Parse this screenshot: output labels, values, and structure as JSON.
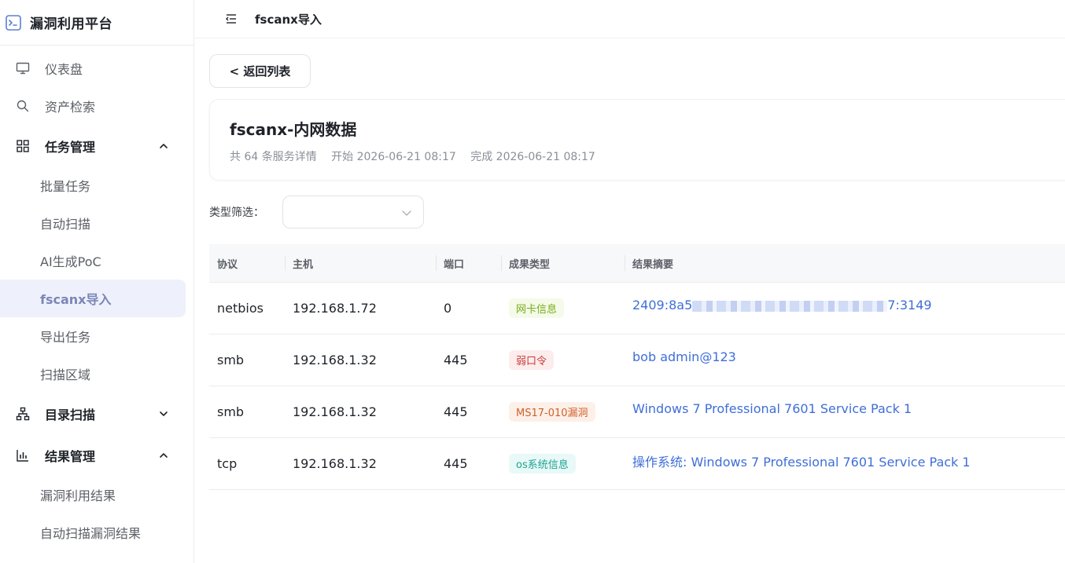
{
  "sidebar": {
    "brand": "漏洞利用平台",
    "items": {
      "dashboard": "仪表盘",
      "asset_search": "资产检索",
      "task_mgmt": "任务管理",
      "batch_task": "批量任务",
      "auto_scan": "自动扫描",
      "ai_poc": "AI生成PoC",
      "fscanx_import": "fscanx导入",
      "export_task": "导出任务",
      "scan_area": "扫描区域",
      "dir_scan": "目录扫描",
      "result_mgmt": "结果管理",
      "exploit_results": "漏洞利用结果",
      "auto_scan_results": "自动扫描漏洞结果"
    }
  },
  "topbar": {
    "crumb": "fscanx导入"
  },
  "back_button": "< 返回列表",
  "info": {
    "title": "fscanx-内网数据",
    "count": "共 64 条服务详情",
    "start": "开始 2026-06-21 08:17",
    "finish": "完成 2026-06-21 08:17"
  },
  "filter": {
    "label": "类型筛选："
  },
  "table": {
    "headers": [
      "协议",
      "主机",
      "端口",
      "成果类型",
      "结果摘要"
    ],
    "rows": [
      {
        "protocol": "netbios",
        "host": "192.168.1.72",
        "port": "0",
        "type": "网卡信息",
        "type_color": "green",
        "summary_prefix": "2409:8a5",
        "summary_suffix": "7:3149",
        "redacted": true
      },
      {
        "protocol": "smb",
        "host": "192.168.1.32",
        "port": "445",
        "type": "弱口令",
        "type_color": "red",
        "summary": "bob admin@123"
      },
      {
        "protocol": "smb",
        "host": "192.168.1.32",
        "port": "445",
        "type": "MS17-010漏洞",
        "type_color": "orange",
        "summary": "Windows 7 Professional 7601 Service Pack 1"
      },
      {
        "protocol": "tcp",
        "host": "192.168.1.32",
        "port": "445",
        "type": "os系统信息",
        "type_color": "cyan",
        "summary": "操作系统: Windows 7 Professional 7601 Service Pack 1"
      }
    ]
  }
}
